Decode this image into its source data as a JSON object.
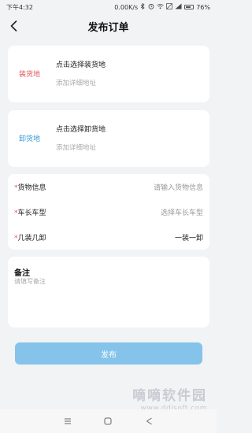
{
  "status_bar": {
    "time": "下午4:32",
    "network": "0.00K/s",
    "battery": "76%"
  },
  "header": {
    "title": "发布订单"
  },
  "loading": {
    "tag": "装货地",
    "main": "点击选择装货地",
    "sub": "添加详细地址"
  },
  "unloading": {
    "tag": "卸货地",
    "main": "点击选择卸货地",
    "sub": "添加详细地址"
  },
  "form": {
    "rows": [
      {
        "required": "*",
        "label": "货物信息",
        "value": "请输入货物信息"
      },
      {
        "required": "*",
        "label": "车长车型",
        "value": "选择车长车型"
      },
      {
        "required": "*",
        "label": "几装几卸",
        "value": "一装一卸"
      }
    ]
  },
  "note": {
    "title": "备注",
    "placeholder": "请填写备注"
  },
  "publish": {
    "label": "发布"
  },
  "watermark": {
    "cn": "嘀嘀软件园",
    "url": "www.ddisoft.com"
  },
  "colors": {
    "accent": "#85c3ea",
    "load": "#e0585c",
    "unload": "#3a9ad9",
    "background": "#f2f3f5"
  }
}
